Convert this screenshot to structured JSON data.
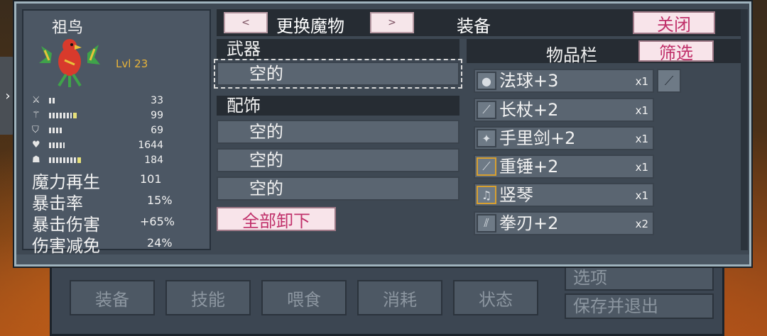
{
  "background": {
    "tabs": [
      "装备",
      "技能",
      "喂食",
      "消耗",
      "状态"
    ],
    "right_buttons": [
      "选项",
      "保存并退出"
    ]
  },
  "monster": {
    "name": "祖鸟",
    "level": "Lvl 23",
    "stats": [
      {
        "icon": "sword-icon",
        "glyph": "⚔",
        "value": "33",
        "bar": 2,
        "bar_hi": false
      },
      {
        "icon": "staff-icon",
        "glyph": "⚚",
        "value": "99",
        "bar": 7,
        "bar_hi": true
      },
      {
        "icon": "shield-icon",
        "glyph": "⛉",
        "value": "69",
        "bar": 4,
        "bar_hi": false
      },
      {
        "icon": "heart-icon",
        "glyph": "♥",
        "value": "1644",
        "bar": 5,
        "bar_hi": false
      },
      {
        "icon": "mana-icon",
        "glyph": "☗",
        "value": "184",
        "bar": 9,
        "bar_hi": true
      }
    ],
    "attributes": [
      {
        "label": "魔力再生",
        "value": "101"
      },
      {
        "label": "暴击率",
        "value": "15%"
      },
      {
        "label": "暴击伤害",
        "value": "+65%"
      },
      {
        "label": "伤害减免",
        "value": "24%"
      }
    ]
  },
  "top_bar": {
    "prev_label": "<",
    "next_label": ">",
    "change_label": "更换魔物",
    "title": "装备",
    "close_label": "关闭"
  },
  "equipment": {
    "weapon_header": "武器",
    "weapon_slot": "空的",
    "accessory_header": "配饰",
    "accessory_slots": [
      "空的",
      "空的",
      "空的"
    ],
    "unequip_all_label": "全部卸下"
  },
  "inventory": {
    "title": "物品栏",
    "filter_label": "筛选",
    "items": [
      {
        "name": "法球+3",
        "qty": "x1",
        "icon": "orb-icon",
        "glyph": "●",
        "gold": false
      },
      {
        "name": "长杖+2",
        "qty": "x1",
        "icon": "staff-icon",
        "glyph": "⟋",
        "gold": false
      },
      {
        "name": "手里剑+2",
        "qty": "x1",
        "icon": "shuriken-icon",
        "glyph": "✦",
        "gold": false
      },
      {
        "name": "重锤+2",
        "qty": "x1",
        "icon": "hammer-icon",
        "glyph": "⟋",
        "gold": true
      },
      {
        "name": "竖琴",
        "qty": "x1",
        "icon": "harp-icon",
        "glyph": "♫",
        "gold": true
      },
      {
        "name": "拳刃+2",
        "qty": "x2",
        "icon": "claw-icon",
        "glyph": "⫽",
        "gold": false
      }
    ]
  }
}
